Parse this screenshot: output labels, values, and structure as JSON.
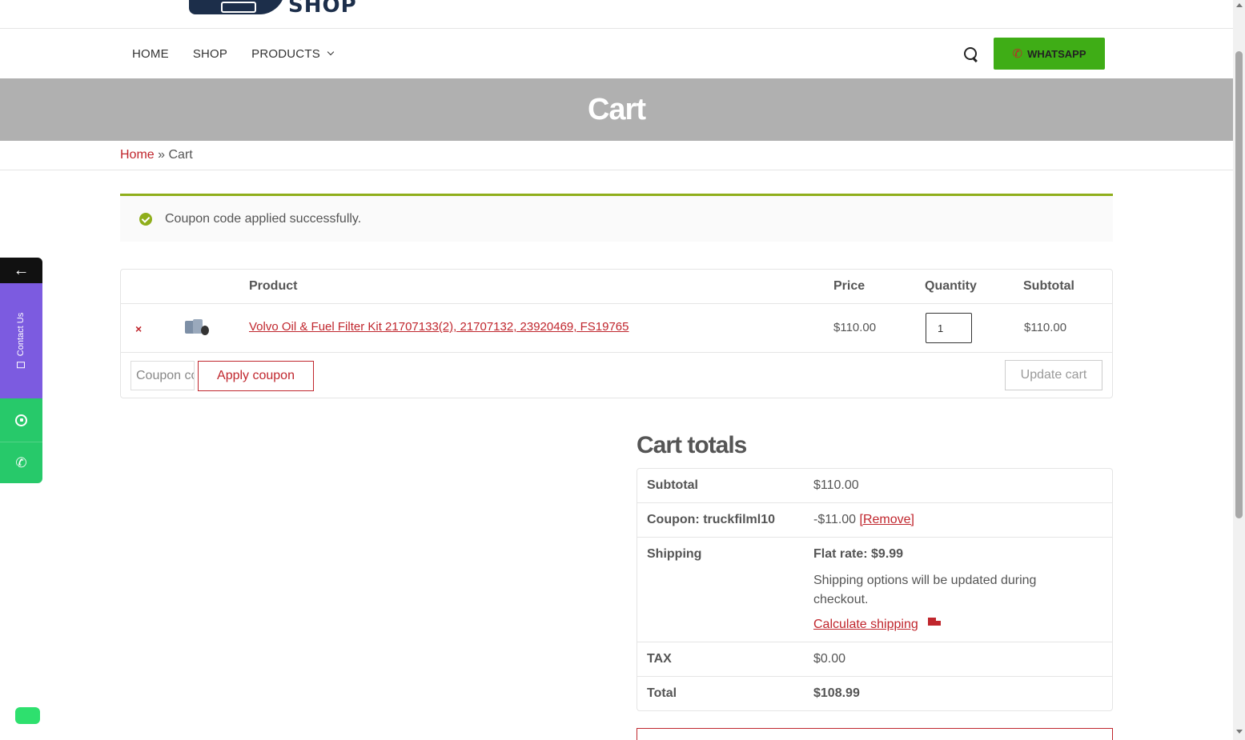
{
  "logo": {
    "text": "SHOP"
  },
  "nav": {
    "items": [
      "HOME",
      "SHOP",
      "PRODUCTS"
    ],
    "whatsapp_label": "WHATSAPP"
  },
  "page": {
    "title": "Cart"
  },
  "breadcrumb": {
    "home": "Home",
    "separator": "»",
    "current": "Cart"
  },
  "notice": {
    "message": "Coupon code applied successfully."
  },
  "cart": {
    "headers": {
      "product": "Product",
      "price": "Price",
      "quantity": "Quantity",
      "subtotal": "Subtotal"
    },
    "items": [
      {
        "remove": "×",
        "name": "Volvo Oil & Fuel Filter Kit 21707133(2), 21707132, 23920469, FS19765",
        "price": "$110.00",
        "quantity": "1",
        "subtotal": "$110.00"
      }
    ],
    "coupon_placeholder": "Coupon code",
    "apply_label": "Apply coupon",
    "update_label": "Update cart"
  },
  "totals": {
    "title": "Cart totals",
    "subtotal_label": "Subtotal",
    "subtotal_value": "$110.00",
    "coupon_label": "Coupon: truckfilml10",
    "coupon_value": "-$11.00",
    "coupon_remove": "[Remove]",
    "shipping_label": "Shipping",
    "shipping_rate": "Flat rate: $9.99",
    "shipping_note": "Shipping options will be updated during checkout.",
    "calc_shipping": "Calculate shipping",
    "tax_label": "TAX",
    "tax_value": "$0.00",
    "total_label": "Total",
    "total_value": "$108.99"
  },
  "side_widget": {
    "back": "←",
    "contact": "Contact Us"
  },
  "colors": {
    "accent": "#c0262d",
    "whatsapp": "#3fad16",
    "success": "#8fae1b",
    "contact": "#7c5be0",
    "social": "#27c96a"
  }
}
